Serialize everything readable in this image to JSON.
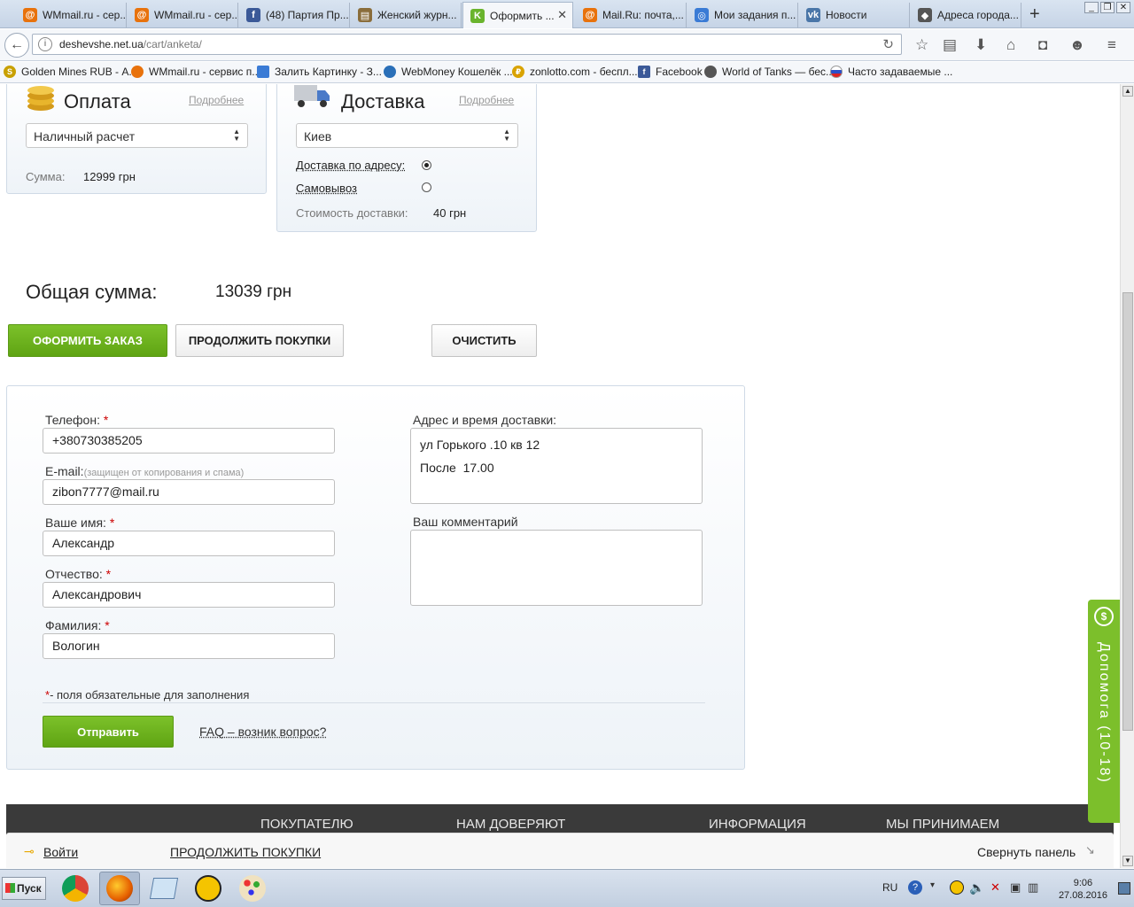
{
  "browser": {
    "tabs": [
      {
        "label": "WMmail.ru - сер...",
        "icon": "at-icon",
        "color": "#e8720c"
      },
      {
        "label": "WMmail.ru - сер...",
        "icon": "at-icon",
        "color": "#e8720c"
      },
      {
        "label": "(48) Партия Пр...",
        "icon": "facebook-icon",
        "color": "#3b5998"
      },
      {
        "label": "Женский журн...",
        "icon": "magazine-icon",
        "color": "#8a6d3b"
      },
      {
        "label": "Оформить ...",
        "icon": "site-icon",
        "color": "#6ab42d",
        "active": true
      },
      {
        "label": "Mail.Ru: почта,...",
        "icon": "at-icon",
        "color": "#e8720c"
      },
      {
        "label": "Мои задания п...",
        "icon": "tasks-icon",
        "color": "#3a7bd5"
      },
      {
        "label": "Новости",
        "icon": "vk-icon",
        "color": "#4a76a8"
      },
      {
        "label": "Адреса города...",
        "icon": "map-icon",
        "color": "#555555"
      }
    ],
    "new_tab": "+",
    "url_host": "deshevshe.net.ua",
    "url_path": "/cart/anketa/",
    "bookmarks": [
      {
        "label": "Golden Mines RUB - А...",
        "color": "#c8a000"
      },
      {
        "label": "WMmail.ru - сервис п...",
        "color": "#e8720c"
      },
      {
        "label": "Залить Картинку - З...",
        "color": "#3a7bd5"
      },
      {
        "label": "WebMoney Кошелёк ...",
        "color": "#2a6fb8"
      },
      {
        "label": "zonlotto.com - беспл...",
        "color": "#d9a300"
      },
      {
        "label": "Facebook",
        "color": "#3b5998"
      },
      {
        "label": "World of Tanks — бес...",
        "color": "#555555"
      },
      {
        "label": "Часто задаваемые ...",
        "color": "#c0392b"
      }
    ]
  },
  "payment": {
    "title": "Оплата",
    "more": "Подробнее",
    "method": "Наличный расчет",
    "sum_label": "Сумма:",
    "sum_value": "12999 грн"
  },
  "delivery": {
    "title": "Доставка",
    "more": "Подробнее",
    "city": "Киев",
    "option_address": "Доставка по адресу:",
    "option_pickup": "Самовывоз",
    "selected": "address",
    "cost_label": "Стоимость доставки:",
    "cost_value": "40 грн"
  },
  "total": {
    "label": "Общая сумма:",
    "value": "13039 грн"
  },
  "actions": {
    "checkout": "ОФОРМИТЬ ЗАКАЗ",
    "continue": "ПРОДОЛЖИТЬ ПОКУПКИ",
    "clear": "ОЧИСТИТЬ"
  },
  "form": {
    "phone_label": "Телефон:",
    "phone_value": "+380730385205",
    "email_label": "E-mail:",
    "email_note": "(защищен от копирования и спама)",
    "email_value": "zibon7777@mail.ru",
    "name_label": "Ваше имя:",
    "name_value": "Александр",
    "patronymic_label": "Отчество:",
    "patronymic_value": "Александрович",
    "surname_label": "Фамилия:",
    "surname_value": "Вологин",
    "address_label": "Адрес и время доставки:",
    "address_value": "ул Горького .10 кв 12\nПосле  17.00",
    "comment_label": "Ваш комментарий",
    "comment_value": "",
    "required_mark": "*",
    "required_note": "- поля обязательные для заполнения",
    "submit": "Отправить",
    "faq": "FAQ – возник вопрос?"
  },
  "footer": {
    "col1": "ПОКУПАТЕЛЮ",
    "col2": "НАМ ДОВЕРЯЮТ",
    "col3": "ИНФОРМАЦИЯ",
    "col4": "МЫ ПРИНИМАЕМ"
  },
  "bottom_panel": {
    "login": "Войти",
    "continue": "ПРОДОЛЖИТЬ ПОКУПКИ",
    "collapse": "Свернуть панель"
  },
  "help_tab": {
    "icon": "$",
    "text": "Допомога (10-18)"
  },
  "taskbar": {
    "start": "Пуск",
    "lang": "RU",
    "time": "9:06",
    "date": "27.08.2016"
  }
}
